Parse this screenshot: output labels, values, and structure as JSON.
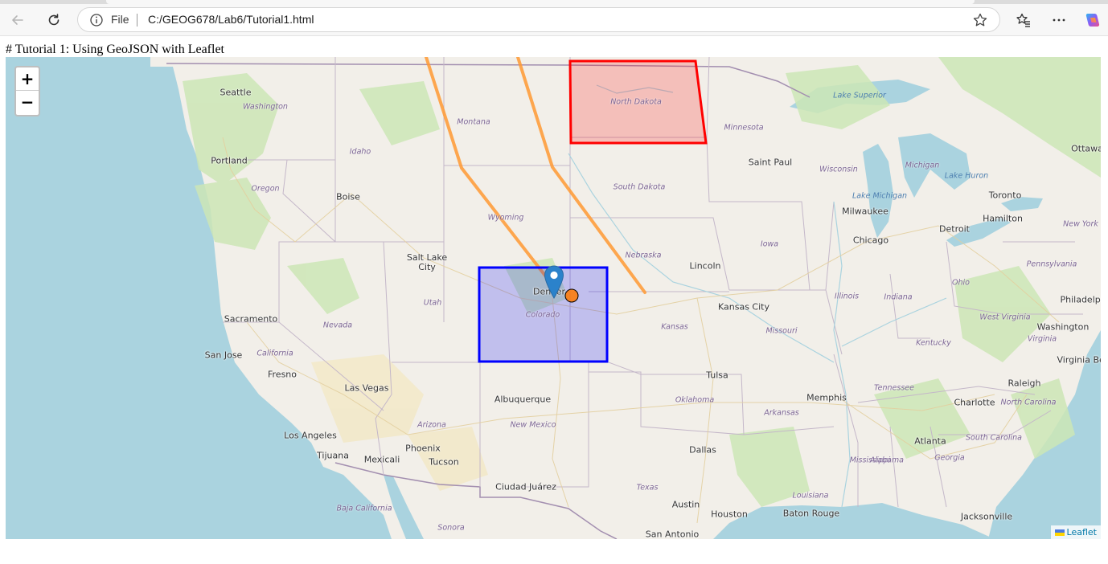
{
  "browser": {
    "scheme_label": "File",
    "url": "C:/GEOG678/Lab6/Tutorial1.html",
    "icons": [
      "back-arrow-icon",
      "reload-icon",
      "info-icon",
      "star-icon",
      "favorites-icon",
      "more-icon",
      "copilot-icon"
    ]
  },
  "page": {
    "heading": "# Tutorial 1: Using GeoJSON with Leaflet"
  },
  "map": {
    "zoom_in_label": "+",
    "zoom_out_label": "−",
    "attribution_label": "Leaflet",
    "overlay_colors": {
      "north_dakota_box": "#ff0000",
      "colorado_box": "#0000ff",
      "route_lines": "#ff9933",
      "circle_marker": "#ff7800",
      "pin_marker": "#2b82cb"
    },
    "cities": [
      "Seattle",
      "Portland",
      "Boise",
      "Salt Lake City",
      "Sacramento",
      "San Jose",
      "Fresno",
      "Las Vegas",
      "Los Angeles",
      "Tijuana",
      "Mexicali",
      "Phoenix",
      "Tucson",
      "Albuquerque",
      "Ciudad Juárez",
      "Denver",
      "Lincoln",
      "Kansas City",
      "Tulsa",
      "Dallas",
      "Austin",
      "Houston",
      "San Antonio",
      "Saint Paul",
      "Milwaukee",
      "Chicago",
      "Detroit",
      "Toronto",
      "Hamilton",
      "Ottawa",
      "Memphis",
      "Atlanta",
      "Charlotte",
      "Raleigh",
      "Washington",
      "Philadelphia",
      "Virginia Beach",
      "Jacksonville",
      "Baton Rouge"
    ],
    "states": [
      "Washington",
      "Oregon",
      "Idaho",
      "Montana",
      "Wyoming",
      "Utah",
      "Nevada",
      "California",
      "Arizona",
      "New Mexico",
      "Colorado",
      "North Dakota",
      "South Dakota",
      "Nebraska",
      "Kansas",
      "Oklahoma",
      "Texas",
      "Minnesota",
      "Iowa",
      "Missouri",
      "Arkansas",
      "Louisiana",
      "Wisconsin",
      "Illinois",
      "Michigan",
      "Indiana",
      "Ohio",
      "Kentucky",
      "Tennessee",
      "Mississippi",
      "Alabama",
      "Georgia",
      "West Virginia",
      "Virginia",
      "North Carolina",
      "South Carolina",
      "Pennsylvania",
      "New York",
      "Baja California",
      "Sonora"
    ],
    "water": [
      "Lake Superior",
      "Lake Michigan",
      "Lake Huron"
    ]
  }
}
